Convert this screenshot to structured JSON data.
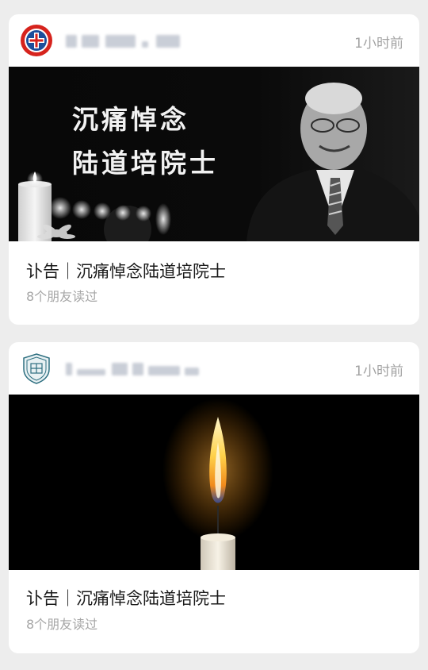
{
  "feed": {
    "articles": [
      {
        "timestamp": "1小时前",
        "cover_line1": "沉痛悼念",
        "cover_line2": "陆道培院士",
        "title": "讣告｜沉痛悼念陆道培院士",
        "read_count": "8个朋友读过",
        "avatar_icon": "red-cross-hospital-logo",
        "cover_icon": "candles-portrait-image"
      },
      {
        "timestamp": "1小时前",
        "title": "讣告｜沉痛悼念陆道培院士",
        "read_count": "8个朋友读过",
        "avatar_icon": "university-shield-logo",
        "cover_icon": "candle-flame-image"
      }
    ]
  },
  "colors": {
    "page_background": "#ededed",
    "card_background": "#ffffff",
    "timestamp_text": "#a3a3a3",
    "read_count_text": "#a6a6a6"
  }
}
